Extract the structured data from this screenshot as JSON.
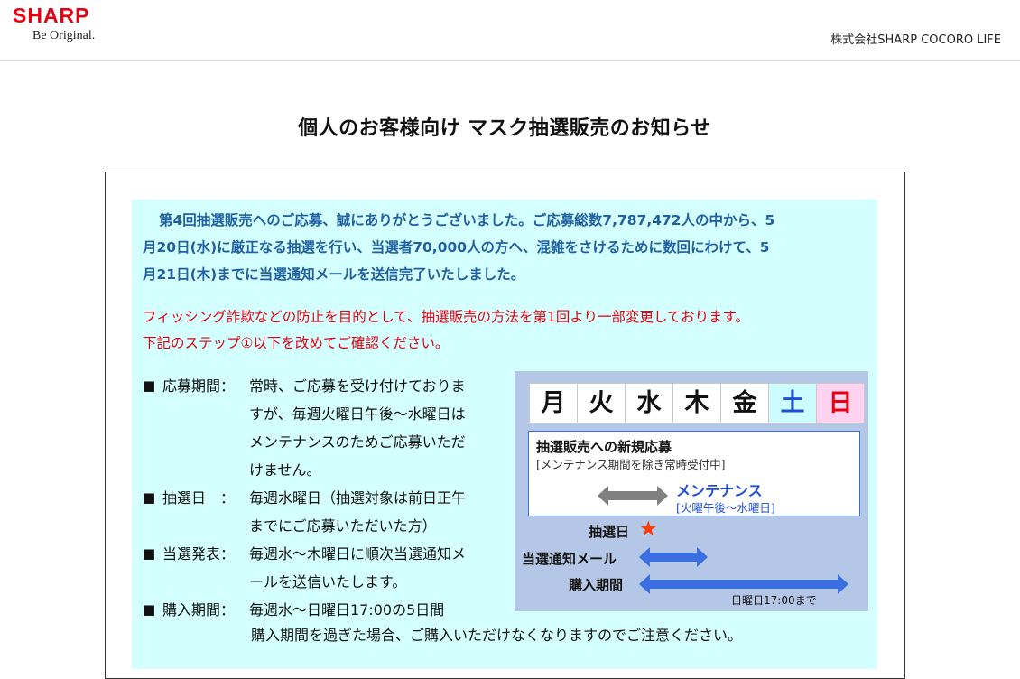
{
  "header": {
    "logo_text": "SHARP",
    "logo_tagline": "Be Original.",
    "company": "株式会社SHARP COCORO LIFE"
  },
  "page_title": "個人のお客様向け マスク抽選販売のお知らせ",
  "intro": {
    "line1": "第4回抽選販売へのご応募、誠にありがとうございました。ご応募総数7,787,472人の中から、5",
    "line2": "月20日(水)に厳正なる抽選を行い、当選者70,000人の方へ、混雑をさけるために数回にわけて、5",
    "line3": "月21日(木)までに当選通知メールを送信完了いたしました。"
  },
  "warning": {
    "line1": "フィッシング詐欺などの防止を目的として、抽選販売の方法を第1回より一部変更しております。",
    "line2": "下記のステップ①以下を改めてご確認ください。"
  },
  "schedule": [
    {
      "bullet": "■",
      "label": "応募期間：",
      "lines": [
        "常時、ご応募を受け付けておりま",
        "すが、毎週火曜日午後〜水曜日は",
        "メンテナンスのためご応募いただ",
        "けません。"
      ]
    },
    {
      "bullet": "■",
      "label": "抽選日　：",
      "lines": [
        "毎週水曜日（抽選対象は前日正午",
        "までにご応募いただいた方）"
      ]
    },
    {
      "bullet": "■",
      "label": "当選発表：",
      "lines": [
        "毎週水〜木曜日に順次当選通知メ",
        "ールを送信いたします。"
      ]
    },
    {
      "bullet": "■",
      "label": "購入期間：",
      "lines": [
        "毎週水〜日曜日17:00の5日間"
      ]
    }
  ],
  "purchase_note": "購入期間を過ぎた場合、ご購入いただけなくなりますのでご注意ください。",
  "diagram": {
    "days": [
      "月",
      "火",
      "水",
      "木",
      "金",
      "土",
      "日"
    ],
    "new_app_title": "抽選販売への新規応募",
    "new_app_sub": "[メンテナンス期間を除き常時受付中]",
    "maint_title": "メンテナンス",
    "maint_sub": "[火曜午後〜水曜日]",
    "draw_label": "抽選日",
    "star": "★",
    "notice_label": "当選通知メール",
    "buy_label": "購入期間",
    "until_label": "日曜日17:00まで",
    "colors": {
      "arrow_blue": "#3b6fe0",
      "arrow_gray": "#808080",
      "bg": "#b4c7e7"
    }
  }
}
